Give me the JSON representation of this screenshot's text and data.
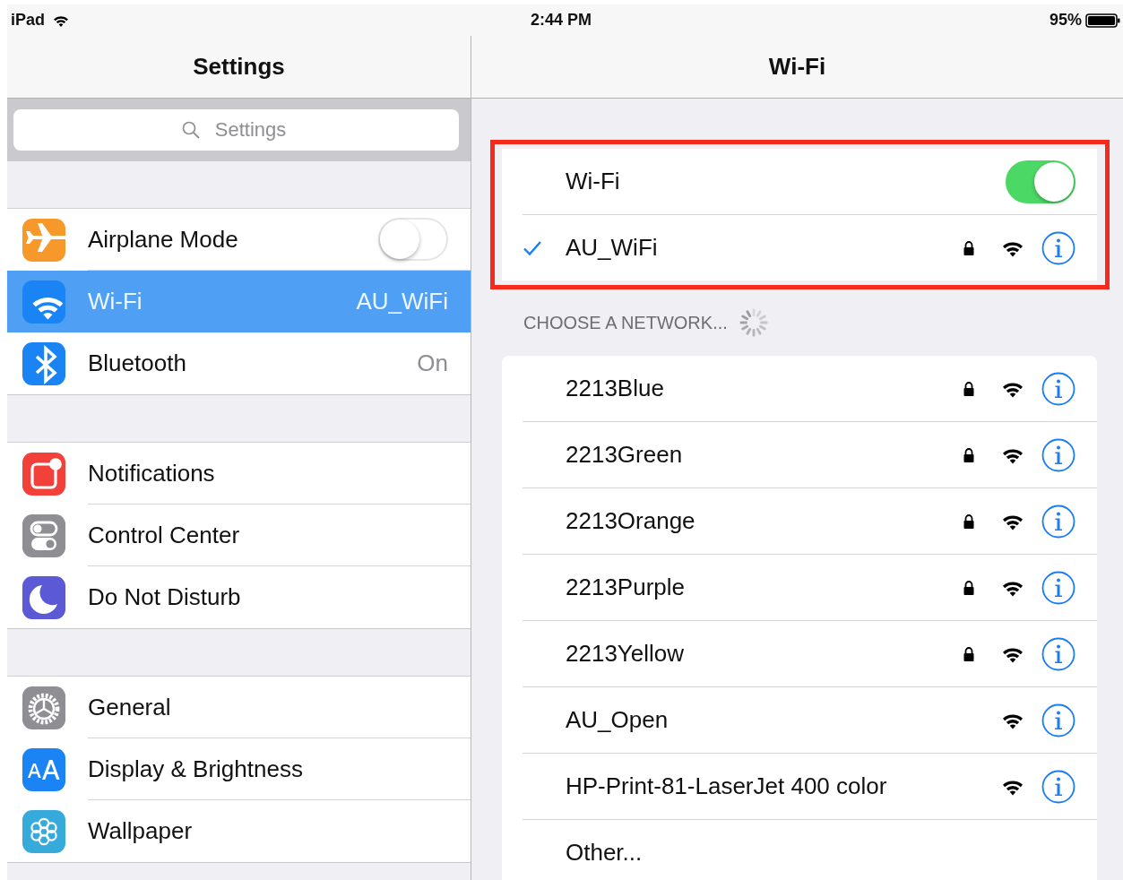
{
  "status_bar": {
    "device": "iPad",
    "time": "2:44 PM",
    "battery": "95%"
  },
  "sidebar": {
    "title": "Settings",
    "search": {
      "placeholder": "Settings"
    },
    "groups": [
      {
        "items": [
          {
            "label": "Airplane Mode",
            "color": "#f7982a",
            "kind": "toggle",
            "on": false,
            "selected": false
          },
          {
            "label": "Wi-Fi",
            "color": "#1a84f4",
            "kind": "value",
            "value": "AU_WiFi",
            "selected": true
          },
          {
            "label": "Bluetooth",
            "color": "#1a84f4",
            "kind": "value",
            "value": "On",
            "selected": false
          }
        ]
      },
      {
        "items": [
          {
            "label": "Notifications",
            "color": "#f2403a",
            "kind": "link",
            "selected": false
          },
          {
            "label": "Control Center",
            "color": "#8e8e93",
            "kind": "link",
            "selected": false
          },
          {
            "label": "Do Not Disturb",
            "color": "#5b59d6",
            "kind": "link",
            "selected": false
          }
        ]
      },
      {
        "items": [
          {
            "label": "General",
            "color": "#8e8e93",
            "kind": "link",
            "selected": false
          },
          {
            "label": "Display & Brightness",
            "color": "#1a84f4",
            "kind": "link",
            "selected": false
          },
          {
            "label": "Wallpaper",
            "color": "#37aadc",
            "kind": "link",
            "selected": false
          }
        ]
      }
    ]
  },
  "detail": {
    "title": "Wi-Fi",
    "wifi_switch": {
      "label": "Wi-Fi",
      "on": true
    },
    "connected": {
      "name": "AU_WiFi",
      "checked": true,
      "locked": true
    },
    "section_header": "CHOOSE A NETWORK...",
    "networks": [
      {
        "name": "2213Blue",
        "kind": "network",
        "locked": true
      },
      {
        "name": "2213Green",
        "kind": "network",
        "locked": true
      },
      {
        "name": "2213Orange",
        "kind": "network",
        "locked": true
      },
      {
        "name": "2213Purple",
        "kind": "network",
        "locked": true
      },
      {
        "name": "2213Yellow",
        "kind": "network",
        "locked": true
      },
      {
        "name": "AU_Open",
        "kind": "network",
        "locked": false
      },
      {
        "name": "HP-Print-81-LaserJet 400 color",
        "kind": "network",
        "locked": false
      },
      {
        "name": "Other...",
        "kind": "other"
      }
    ]
  }
}
